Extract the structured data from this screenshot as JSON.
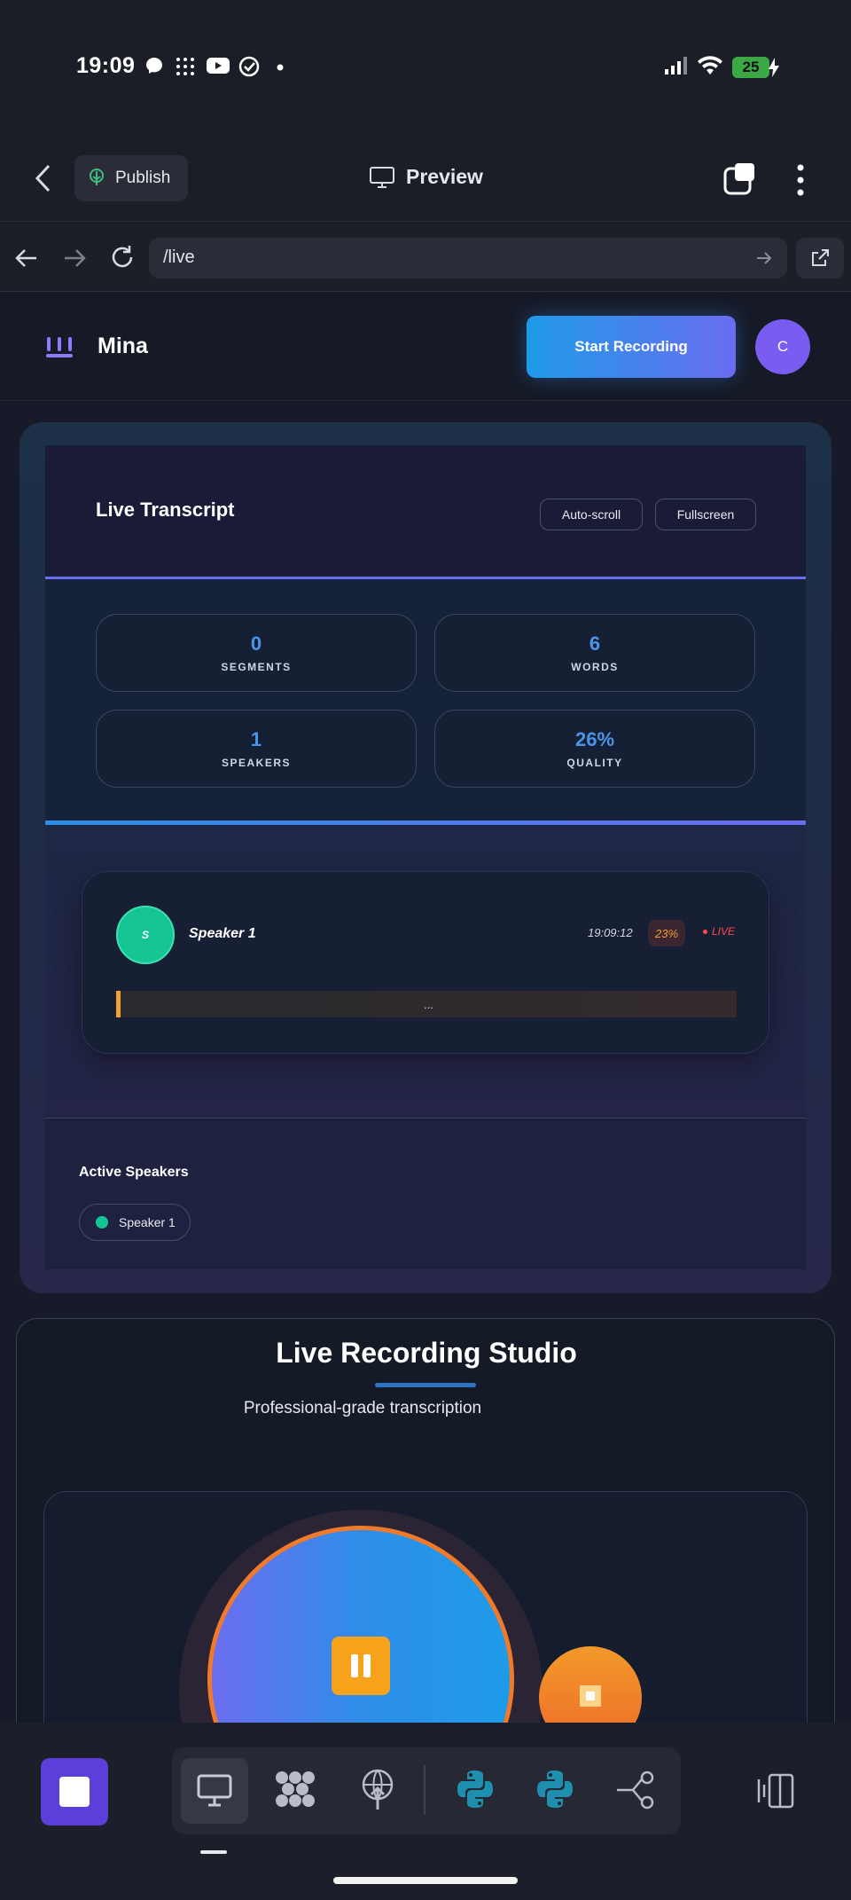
{
  "status_bar": {
    "time": "19:09",
    "battery": "25",
    "icons": [
      "messenger-icon",
      "dots-grid-icon",
      "youtube-icon",
      "check-circle-icon",
      "dot-icon",
      "signal-icon",
      "wifi-icon",
      "battery-icon"
    ]
  },
  "app_header": {
    "publish_label": "Publish",
    "preview_label": "Preview"
  },
  "url_bar": {
    "url": "/live"
  },
  "site": {
    "brand": "Mina",
    "start_recording": "Start Recording",
    "avatar_initial": "C",
    "accent": "#6a6cf0"
  },
  "transcript": {
    "title": "Live Transcript",
    "autoscroll": "Auto-scroll",
    "fullscreen": "Fullscreen",
    "stats": [
      {
        "value": "0",
        "label": "SEGMENTS"
      },
      {
        "value": "6",
        "label": "WORDS"
      },
      {
        "value": "1",
        "label": "SPEAKERS"
      },
      {
        "value": "26%",
        "label": "QUALITY"
      }
    ],
    "segment": {
      "avatar": "S",
      "speaker": "Speaker 1",
      "time": "19:09:12",
      "confidence": "23%",
      "live": "LIVE",
      "text": "..."
    },
    "active_speakers_title": "Active Speakers",
    "active_speakers": [
      "Speaker 1"
    ]
  },
  "studio": {
    "title": "Live Recording Studio",
    "subtitle": "Professional-grade transcription",
    "pause_icon": "pause-icon",
    "stop_icon": "stop-icon"
  },
  "bottom_toolbar": {
    "icons": [
      "stop-square-icon",
      "monitor-icon",
      "molecule-icon",
      "globe-upload-icon",
      "python-icon",
      "python-icon",
      "share-nodes-icon",
      "panel-toggle-icon"
    ]
  }
}
